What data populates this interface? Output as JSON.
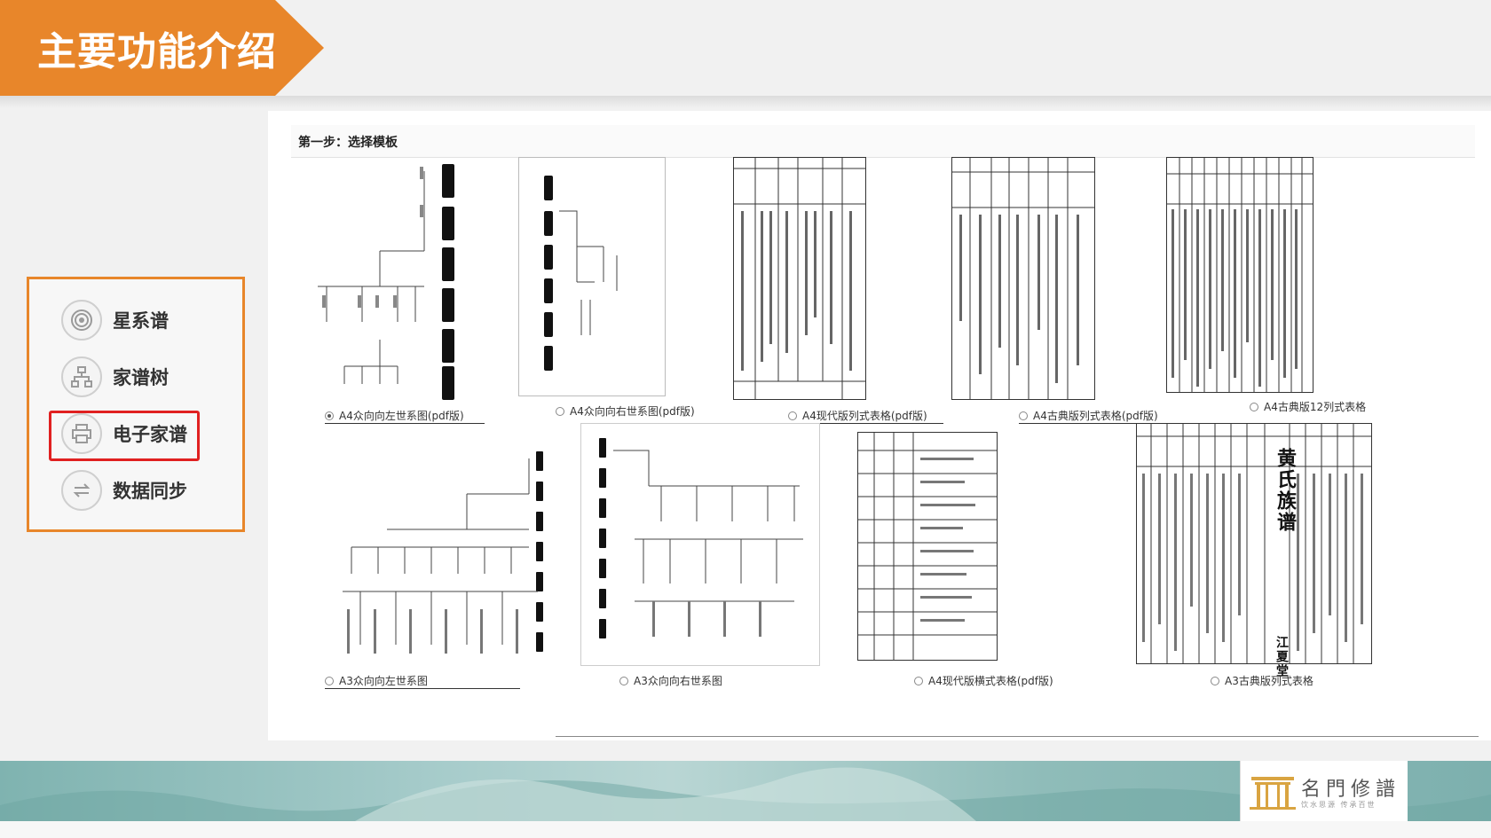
{
  "header": {
    "title": "主要功能介绍"
  },
  "menu": {
    "items": [
      {
        "label": "星系谱",
        "icon": "galaxy-icon"
      },
      {
        "label": "家谱树",
        "icon": "tree-icon"
      },
      {
        "label": "电子家谱",
        "icon": "printer-icon",
        "active": true
      },
      {
        "label": "数据同步",
        "icon": "sync-icon"
      }
    ]
  },
  "panel": {
    "step_label": "第一步：选择模板",
    "templates": [
      {
        "label": "A4众向向左世系图(pdf版)",
        "selected": true
      },
      {
        "label": "A4众向向右世系图(pdf版)",
        "selected": false
      },
      {
        "label": "A4现代版列式表格(pdf版)",
        "selected": false
      },
      {
        "label": "A4古典版列式表格(pdf版)",
        "selected": false
      },
      {
        "label": "A4古典版12列式表格",
        "selected": false
      },
      {
        "label": "A3众向向左世系图",
        "selected": false
      },
      {
        "label": "A3众向向右世系图",
        "selected": false
      },
      {
        "label": "A4现代版横式表格(pdf版)",
        "selected": false
      },
      {
        "label": "A3古典版列式表格",
        "selected": false
      }
    ],
    "preview_title": "黄氏族谱",
    "preview_hall": "江夏堂"
  },
  "footer": {
    "logo_text": "名門修譜",
    "logo_sub": "饮水思源 传承百世"
  },
  "colors": {
    "accent": "#e8862a",
    "active_border": "#e02020",
    "footer": "#9fc6c4"
  }
}
